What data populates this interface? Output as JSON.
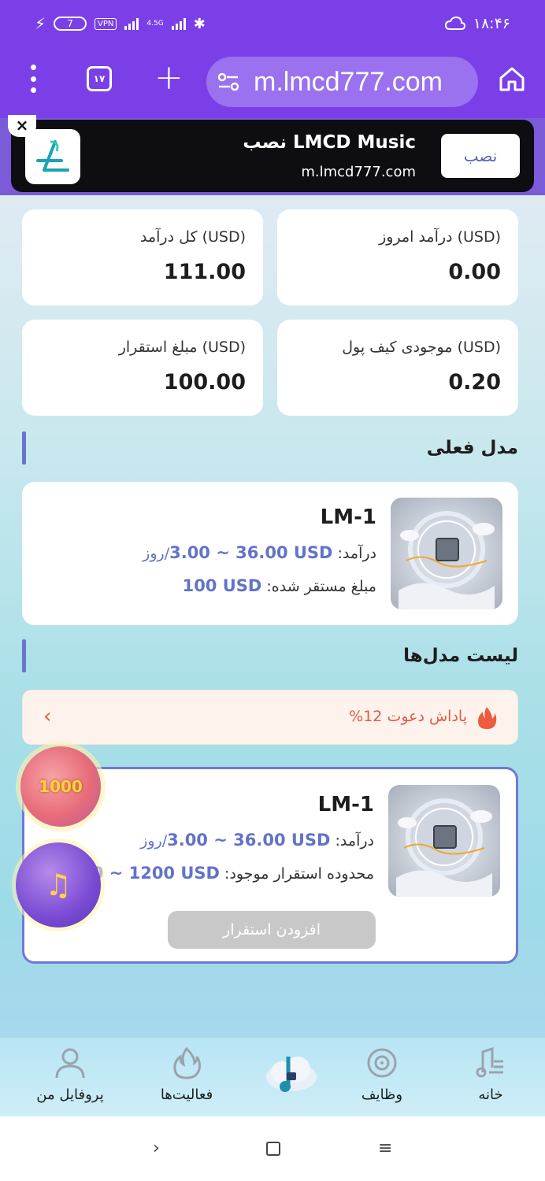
{
  "status_bar": {
    "battery": "7",
    "vpn": "VPN",
    "network": "4.5G",
    "time": "۱۸:۴۶"
  },
  "browser": {
    "tab_count": "۱۷",
    "url": "m.lmcd777.com"
  },
  "install_banner": {
    "title": "نصب LMCD Music",
    "url": "m.lmcd777.com",
    "install_label": "نصب",
    "close": "×"
  },
  "stats": {
    "today_income": {
      "label": "درآمد امروز (USD)",
      "value": "0.00"
    },
    "total_income": {
      "label": "کل درآمد (USD)",
      "value": "111.00"
    },
    "wallet_balance": {
      "label": "موجودی کیف پول (USD)",
      "value": "0.20"
    },
    "staked_amount": {
      "label": "مبلغ استقرار (USD)",
      "value": "100.00"
    }
  },
  "current_model": {
    "section_title": "مدل فعلی",
    "name": "LM-1",
    "income_label": "درآمد:",
    "income_range": "3.00 ~ 36.00 USD",
    "income_unit": "/روز",
    "staked_label": "مبلغ مستقر شده:",
    "staked_value": "100 USD"
  },
  "models_list": {
    "section_title": "لیست مدل‌ها",
    "referral_text": "پاداش دعوت 12%",
    "items": [
      {
        "name": "LM-1",
        "income_label": "درآمد:",
        "income_range": "3.00 ~ 36.00 USD",
        "income_unit": "/روز",
        "range_label": "محدوده استقرار موجود:",
        "range_value": "100 ~ 1200 USD",
        "button_label": "افزودن استقرار"
      }
    ]
  },
  "floating": {
    "bonus_text": "1000"
  },
  "bottom_nav": {
    "items": [
      {
        "label": "خانه"
      },
      {
        "label": "وظایف"
      },
      {
        "label": ""
      },
      {
        "label": "فعالیت‌ها"
      },
      {
        "label": "پروفایل من"
      }
    ]
  },
  "colors": {
    "primary": "#7b3fe8",
    "accent": "#6273c7",
    "referral": "#e05a4a"
  }
}
